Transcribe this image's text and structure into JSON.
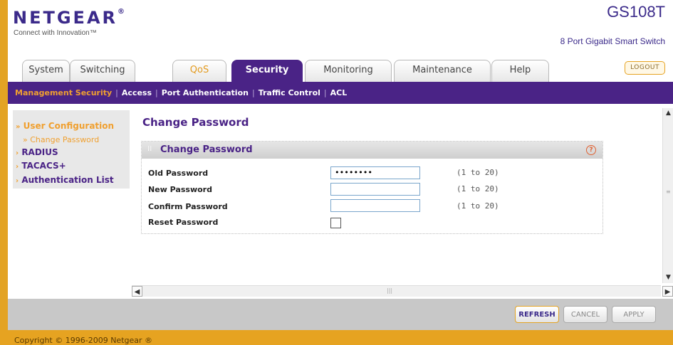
{
  "header": {
    "brand": "NETGEAR",
    "brand_mark": "®",
    "tagline": "Connect with Innovation™",
    "model": "GS108T",
    "model_desc": "8 Port Gigabit Smart Switch",
    "logout_label": "LOGOUT"
  },
  "tabs": [
    {
      "label": "System"
    },
    {
      "label": "Switching"
    },
    {
      "label": "QoS"
    },
    {
      "label": "Security"
    },
    {
      "label": "Monitoring"
    },
    {
      "label": "Maintenance"
    },
    {
      "label": "Help"
    }
  ],
  "subnav": [
    {
      "label": "Management Security"
    },
    {
      "label": "Access"
    },
    {
      "label": "Port Authentication"
    },
    {
      "label": "Traffic Control"
    },
    {
      "label": "ACL"
    }
  ],
  "left_menu": {
    "items": [
      {
        "label": "User Configuration"
      },
      {
        "label": "RADIUS"
      },
      {
        "label": "TACACS+"
      },
      {
        "label": "Authentication List"
      }
    ],
    "sub_item": "Change Password"
  },
  "page": {
    "title": "Change Password",
    "panel_title": "Change Password",
    "fields": [
      {
        "label": "Old Password",
        "value": "••••••••",
        "hint": "(1 to 20)"
      },
      {
        "label": "New Password",
        "value": "",
        "hint": "(1 to 20)"
      },
      {
        "label": "Confirm Password",
        "value": "",
        "hint": "(1 to 20)"
      }
    ],
    "reset_label": "Reset Password"
  },
  "buttons": {
    "refresh": "REFRESH",
    "cancel": "CANCEL",
    "apply": "APPLY"
  },
  "footer": {
    "copyright": "Copyright © 1996-2009 Netgear ®"
  },
  "colors": {
    "brand_purple": "#4a2386",
    "accent_orange": "#e6a321"
  }
}
